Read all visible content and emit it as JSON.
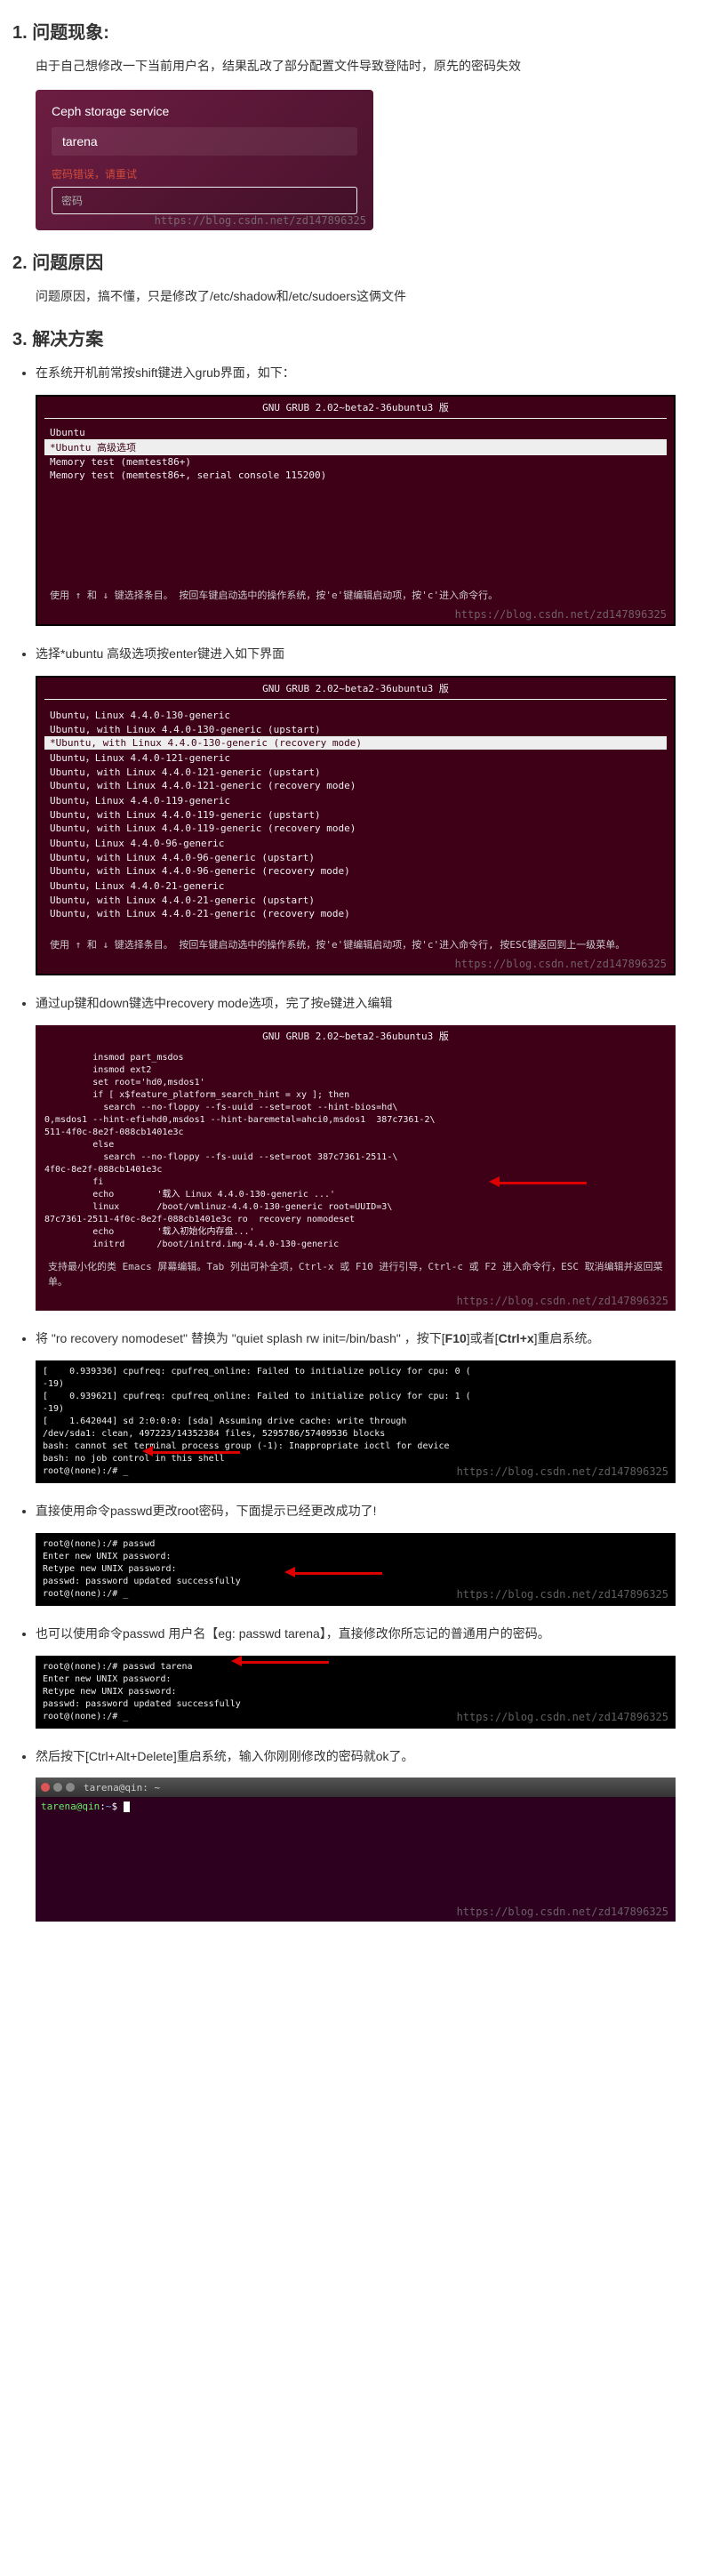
{
  "sections": {
    "s1_title": "1. 问题现象:",
    "s1_text": "由于自己想修改一下当前用户名，结果乱改了部分配置文件导致登陆时，原先的密码失效",
    "s2_title": "2. 问题原因",
    "s2_text": "问题原因，搞不懂，只是修改了/etc/shadow和/etc/sudoers这俩文件",
    "s3_title": "3. 解决方案",
    "bullet1": "在系统开机前常按shift键进入grub界面，如下：",
    "bullet2": "选择*ubuntu 高级选项按enter键进入如下界面",
    "bullet3": "通过up键和down键选中recovery mode选项，完了按e键进入编辑",
    "bullet4_pre": "将 \"ro recovery nomodeset\" 替换为 \"quiet splash rw init=/bin/bash\" ，按下[",
    "bullet4_key1": "F10",
    "bullet4_mid": "]或者[",
    "bullet4_key2": "Ctrl+x",
    "bullet4_post": "]重启系统。",
    "bullet5": "直接使用命令passwd更改root密码，下面提示已经更改成功了!",
    "bullet6": "也可以使用命令passwd 用户名【eg: passwd tarena】，直接修改你所忘记的普通用户的密码。",
    "bullet7": "然后按下[Ctrl+Alt+Delete]重启系统，输入你刚刚修改的密码就ok了。"
  },
  "login": {
    "service": "Ceph storage service",
    "user": "tarena",
    "error": "密码错误，请重试",
    "placeholder": "密码"
  },
  "grub1": {
    "title": "GNU GRUB  2.02~beta2-36ubuntu3 版",
    "lines": [
      "Ubuntu",
      "*Ubuntu 高级选项",
      " Memory test (memtest86+)",
      " Memory test (memtest86+, serial console 115200)"
    ],
    "sel_index": 1,
    "foot": "使用 ↑ 和 ↓ 键选择条目。\n按回车键启动选中的操作系统，按'e'键编辑启动项，按'c'进入命令行。"
  },
  "grub2": {
    "title": "GNU GRUB  2.02~beta2-36ubuntu3 版",
    "lines": [
      "Ubuntu，Linux 4.4.0-130-generic",
      "Ubuntu, with Linux 4.4.0-130-generic (upstart)",
      "*Ubuntu, with Linux 4.4.0-130-generic (recovery mode)",
      "Ubuntu，Linux 4.4.0-121-generic",
      "Ubuntu, with Linux 4.4.0-121-generic (upstart)",
      "Ubuntu, with Linux 4.4.0-121-generic (recovery mode)",
      "Ubuntu，Linux 4.4.0-119-generic",
      "Ubuntu, with Linux 4.4.0-119-generic (upstart)",
      "Ubuntu, with Linux 4.4.0-119-generic (recovery mode)",
      "Ubuntu，Linux 4.4.0-96-generic",
      "Ubuntu, with Linux 4.4.0-96-generic (upstart)",
      "Ubuntu, with Linux 4.4.0-96-generic (recovery mode)",
      "Ubuntu，Linux 4.4.0-21-generic",
      "Ubuntu, with Linux 4.4.0-21-generic (upstart)",
      "Ubuntu, with Linux 4.4.0-21-generic (recovery mode)"
    ],
    "sel_index": 2,
    "foot": "使用 ↑ 和 ↓ 键选择条目。\n按回车键启动选中的操作系统，按'e'键编辑启动项，按'c'进入命令行,\n按ESC键返回到上一级菜单。"
  },
  "grub3": {
    "title": "GNU GRUB  2.02~beta2-36ubuntu3 版",
    "body": "         insmod part_msdos\n         insmod ext2\n         set root='hd0,msdos1'\n         if [ x$feature_platform_search_hint = xy ]; then\n           search --no-floppy --fs-uuid --set=root --hint-bios=hd\\\n0,msdos1 --hint-efi=hd0,msdos1 --hint-baremetal=ahci0,msdos1  387c7361-2\\\n511-4f0c-8e2f-088cb1401e3c\n         else\n           search --no-floppy --fs-uuid --set=root 387c7361-2511-\\\n4f0c-8e2f-088cb1401e3c\n         fi\n         echo        '载入 Linux 4.4.0-130-generic ...'\n         linux       /boot/vmlinuz-4.4.0-130-generic root=UUID=3\\\n87c7361-2511-4f0c-8e2f-088cb1401e3c ro  recovery nomodeset\n         echo        '载入初始化内存盘...'\n         initrd      /boot/initrd.img-4.4.0-130-generic",
    "foot": "支持最小化的类 Emacs 屏幕编辑。Tab 列出可补全项，Ctrl-x 或 F10\n进行引导，Ctrl-c 或 F2 进入命令行，ESC 取消编辑并返回菜单。"
  },
  "term1": {
    "lines": [
      "[    0.939336] cpufreq: cpufreq_online: Failed to initialize policy for cpu: 0 (",
      "-19)",
      "[    0.939621] cpufreq: cpufreq_online: Failed to initialize policy for cpu: 1 (",
      "-19)",
      "[    1.642044] sd 2:0:0:0: [sda] Assuming drive cache: write through",
      "/dev/sda1: clean, 497223/14352384 files, 5295786/57409536 blocks",
      "bash: cannot set terminal process group (-1): Inappropriate ioctl for device",
      "bash: no job control in this shell",
      "root@(none):/# _"
    ]
  },
  "term2": {
    "lines": [
      "root@(none):/# passwd",
      "Enter new UNIX password:",
      "Retype new UNIX password:",
      "passwd: password updated successfully",
      "root@(none):/# _"
    ]
  },
  "term3": {
    "lines": [
      "root@(none):/# passwd tarena",
      "Enter new UNIX password:",
      "Retype new UNIX password:",
      "passwd: password updated successfully",
      "root@(none):/# _"
    ]
  },
  "ubterm": {
    "title": "tarena@qin: ~",
    "prompt_user": "tarena@qin",
    "prompt_path": "~"
  },
  "watermark": "https://blog.csdn.net/zd147896325"
}
